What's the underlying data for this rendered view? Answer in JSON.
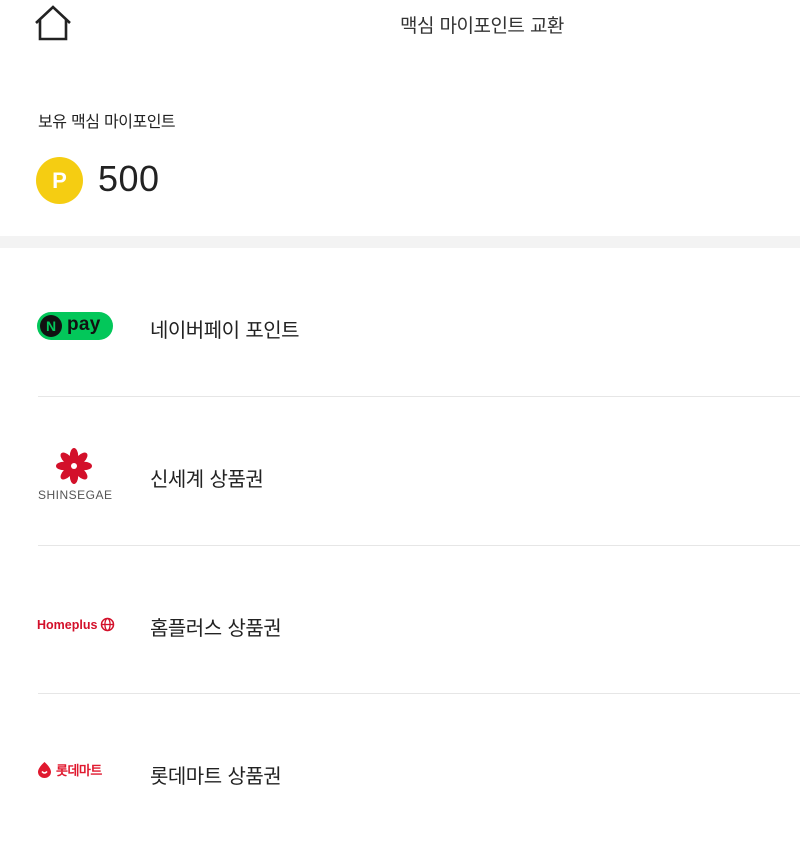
{
  "header": {
    "title": "맥심 마이포인트 교환",
    "home_icon": "home-icon"
  },
  "balance": {
    "label": "보유 맥심 마이포인트",
    "coin_letter": "P",
    "value": "500",
    "coin_color": "#f5cd12"
  },
  "exchange_items": [
    {
      "label": "네이버페이 포인트",
      "logo": {
        "n": "N",
        "text": "pay"
      },
      "brand_color": "#03c75a"
    },
    {
      "label": "신세계 상품권",
      "logo": {
        "text": "SHINSEGAE"
      },
      "brand_color": "#d3102a"
    },
    {
      "label": "홈플러스 상품권",
      "logo": {
        "text": "Homeplus"
      },
      "brand_color": "#d3102a"
    },
    {
      "label": "롯데마트 상품권",
      "logo": {
        "text": "롯데마트"
      },
      "brand_color": "#e0192f"
    }
  ]
}
